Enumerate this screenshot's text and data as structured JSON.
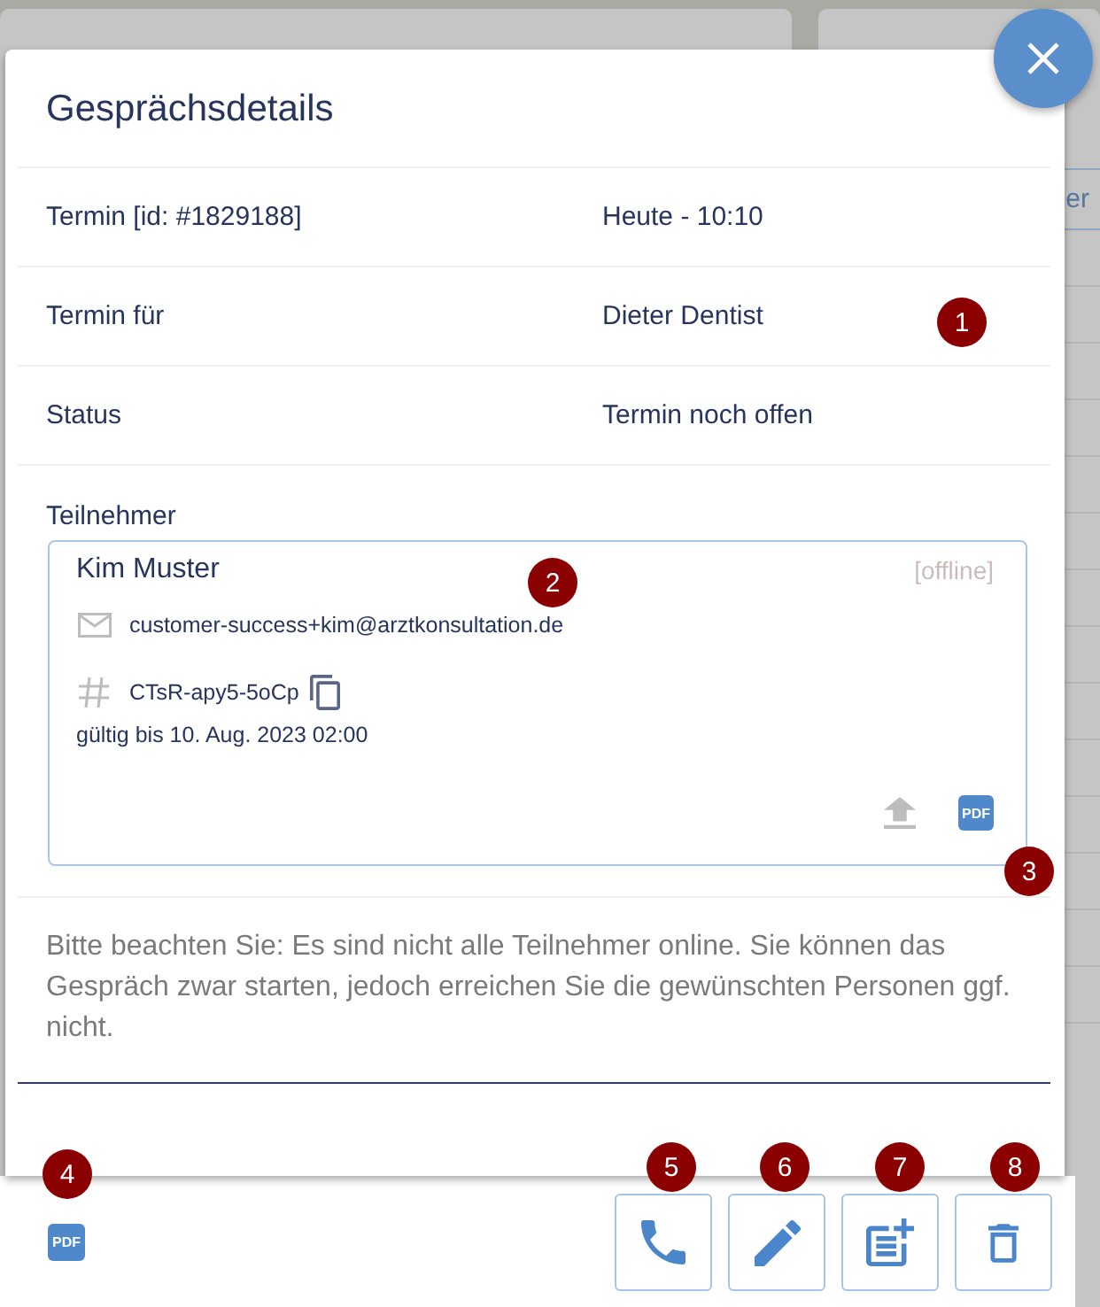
{
  "backdrop": {
    "fragment": "er"
  },
  "dialog": {
    "title": "Gesprächsdetails",
    "details": [
      {
        "label": "Termin [id: #1829188]",
        "value": "Heute - 10:10"
      },
      {
        "label": "Termin für",
        "value": "Dieter Dentist"
      },
      {
        "label": "Status",
        "value": "Termin noch offen"
      }
    ],
    "participants": {
      "label": "Teilnehmer",
      "items": [
        {
          "name": "Kim Muster",
          "online": false,
          "status": "[offline]",
          "email": "customer-success+kim@arztkonsultation.de",
          "code": "CTsR-apy5-5oCp",
          "valid_until": "gültig bis 10. Aug. 2023 02:00",
          "pdf": "PDF"
        }
      ]
    },
    "notice": "Bitte beachten Sie: Es sind nicht alle Teilnehmer online. Sie können das Gespräch zwar starten, jedoch erreichen Sie die gewünschten Personen ggf. nicht."
  },
  "footer": {
    "pdf": "PDF",
    "actions": [
      {
        "kind": "call"
      },
      {
        "kind": "edit"
      },
      {
        "kind": "add-note"
      },
      {
        "kind": "delete"
      }
    ]
  },
  "markers": [
    {
      "label": "1"
    },
    {
      "label": "2"
    },
    {
      "label": "3"
    },
    {
      "label": "4"
    },
    {
      "label": "5"
    },
    {
      "label": "6"
    },
    {
      "label": "7"
    },
    {
      "label": "8"
    }
  ]
}
